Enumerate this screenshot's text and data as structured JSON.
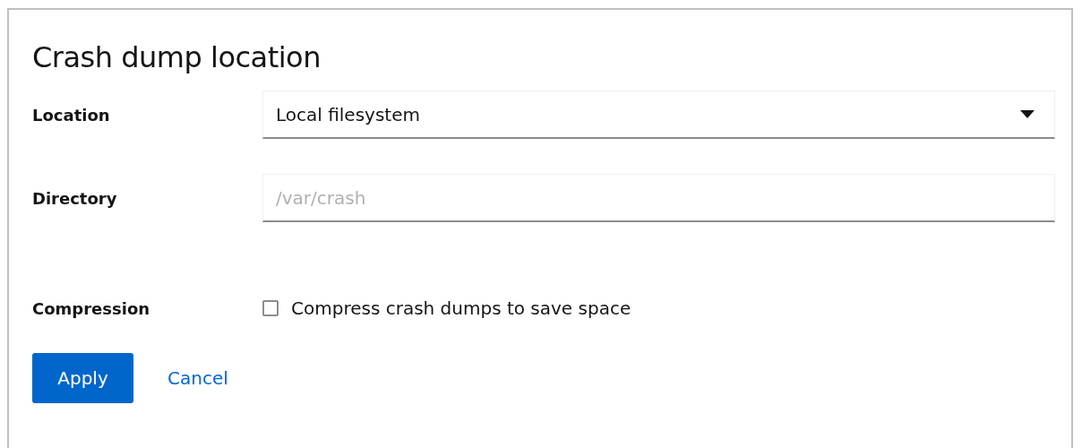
{
  "dialog": {
    "title": "Crash dump location",
    "location": {
      "label": "Location",
      "value": "Local filesystem"
    },
    "directory": {
      "label": "Directory",
      "placeholder": "/var/crash"
    },
    "compression": {
      "label": "Compression",
      "option": "Compress crash dumps to save space",
      "checked": false
    },
    "buttons": [
      {
        "label": "Apply",
        "kind": "primary"
      },
      {
        "label": "Cancel",
        "kind": "link"
      }
    ]
  }
}
